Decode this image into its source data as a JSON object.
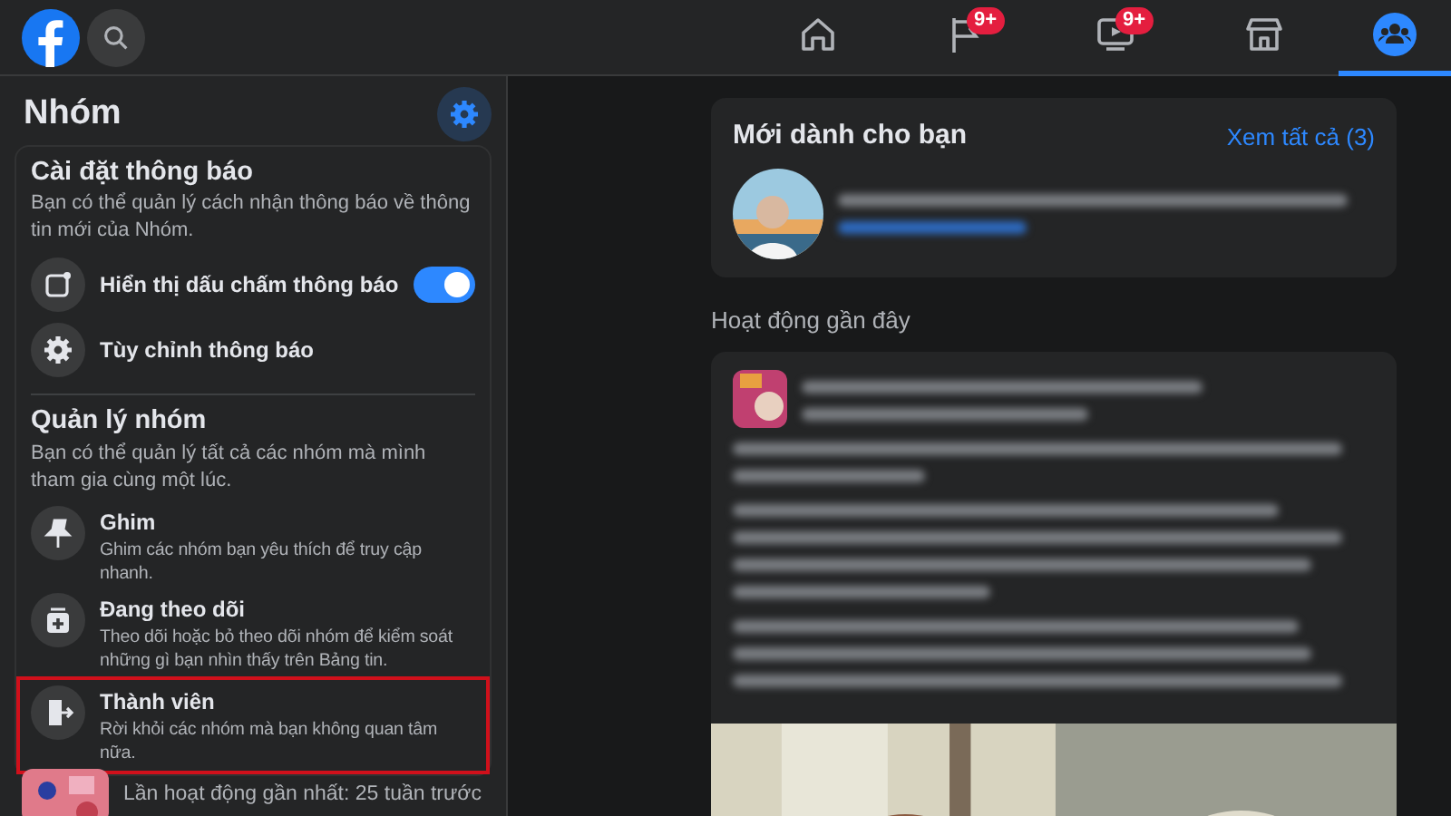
{
  "nav_tabs": [
    {
      "kind": "home",
      "selected": false
    },
    {
      "kind": "flag",
      "badge": "9+",
      "selected": false
    },
    {
      "kind": "video",
      "badge": "9+",
      "selected": false
    },
    {
      "kind": "store",
      "selected": false
    },
    {
      "kind": "groups",
      "selected": true
    }
  ],
  "sidebar": {
    "title": "Nhóm",
    "notifications": {
      "title": "Cài đặt thông báo",
      "description": "Bạn có thể quản lý cách nhận thông báo về thông tin mới của Nhóm.",
      "items": [
        {
          "kind": "toggle",
          "label": "Hiển thị dấu chấm thông báo",
          "on": true
        },
        {
          "kind": "link",
          "label": "Tùy chỉnh thông báo"
        }
      ]
    },
    "manage": {
      "title": "Quản lý nhóm",
      "description": "Bạn có thể quản lý tất cả các nhóm mà mình tham gia cùng một lúc.",
      "items": [
        {
          "label": "Ghim",
          "description": "Ghim các nhóm bạn yêu thích để truy cập nhanh.",
          "highlighted": false
        },
        {
          "label": "Đang theo dõi",
          "description": "Theo dõi hoặc bỏ theo dõi nhóm để kiểm soát những gì bạn nhìn thấy trên Bảng tin.",
          "highlighted": false
        },
        {
          "label": "Thành viên",
          "description": "Rời khỏi các nhóm mà bạn không quan tâm nữa.",
          "highlighted": true
        }
      ]
    },
    "group_meta": "Lần hoạt động gần nhất: 25 tuần trước"
  },
  "feed": {
    "new_for_you": {
      "title": "Mới dành cho bạn",
      "link": "Xem tất cả (3)"
    },
    "recent_title": "Hoạt động gần đây"
  }
}
